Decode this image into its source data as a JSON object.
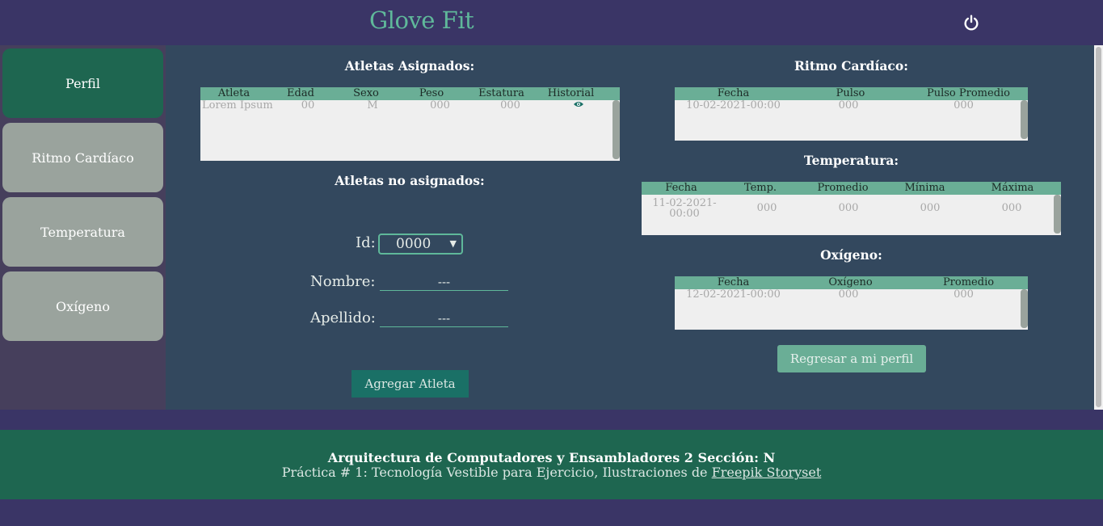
{
  "header": {
    "brand": "Glove Fit",
    "power_icon": "power-icon"
  },
  "sidebar": {
    "items": [
      {
        "label": "Perfil",
        "active": true
      },
      {
        "label": "Ritmo Cardíaco",
        "active": false
      },
      {
        "label": "Temperatura",
        "active": false
      },
      {
        "label": "Oxígeno",
        "active": false
      }
    ]
  },
  "assigned": {
    "title": "Atletas Asignados:",
    "columns": [
      "Atleta",
      "Edad",
      "Sexo",
      "Peso",
      "Estatura",
      "Historial"
    ],
    "row": {
      "atleta": "Lorem Ipsum",
      "edad": "00",
      "sexo": "M",
      "peso": "000",
      "estatura": "000",
      "historial_icon": "eye-icon"
    }
  },
  "unassigned": {
    "title": "Atletas no asignados:",
    "id_label": "Id:",
    "id_value": "0000",
    "nombre_label": "Nombre:",
    "nombre_value": "---",
    "apellido_label": "Apellido:",
    "apellido_value": "---",
    "add_button": "Agregar Atleta"
  },
  "heart": {
    "title": "Ritmo Cardíaco:",
    "columns": [
      "Fecha",
      "Pulso",
      "Pulso Promedio"
    ],
    "row": [
      "10-02-2021-00:00",
      "000",
      "000"
    ]
  },
  "temperature": {
    "title": "Temperatura:",
    "columns": [
      "Fecha",
      "Temp.",
      "Promedio",
      "Mínima",
      "Máxima"
    ],
    "row": [
      "11-02-2021-00:00",
      "000",
      "000",
      "000",
      "000"
    ]
  },
  "oxygen": {
    "title": "Oxígeno:",
    "columns": [
      "Fecha",
      "Oxígeno",
      "Promedio"
    ],
    "row": [
      "12-02-2021-00:00",
      "000",
      "000"
    ]
  },
  "back_button": "Regresar a mi perfil",
  "footer": {
    "line1": "Arquitectura de Computadores y Ensambladores 2 Sección: N",
    "line2_prefix": "Práctica # 1: Tecnología Vestible para Ejercicio, Ilustraciones de ",
    "line2_link": "Freepik Storyset"
  },
  "colors": {
    "brand": "#5fb89a",
    "header_bg": "#3a3566",
    "main_bg": "#33485e",
    "active_tab": "#1e6650",
    "table_header": "#6aae96"
  }
}
